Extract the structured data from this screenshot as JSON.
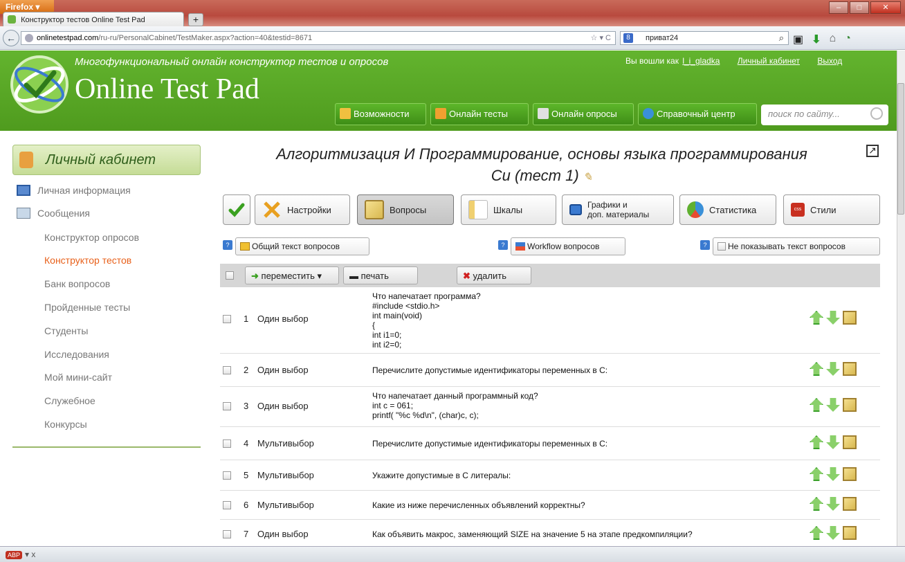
{
  "browser": {
    "menu_button": "Firefox ▾",
    "tab_title": "Конструктор тестов Online Test Pad",
    "url_host": "onlinetestpad.com",
    "url_path": "/ru-ru/PersonalCabinet/TestMaker.aspx?action=40&testid=8671",
    "search_value": "приват24",
    "search_engine": "8",
    "status_text": "x"
  },
  "header": {
    "tagline": "Многофункциональный онлайн конструктор тестов и опросов",
    "brand": "Online Test Pad",
    "logged_in_label": "Вы вошли как",
    "username": "l_i_gladka",
    "cabinet_link": "Личный кабинет",
    "logout_link": "Выход",
    "nav": [
      {
        "label": "Возможности",
        "color": "#f0c040"
      },
      {
        "label": "Онлайн тесты",
        "color": "#f0a030"
      },
      {
        "label": "Онлайн опросы",
        "color": "#e0e0e0"
      },
      {
        "label": "Справочный центр",
        "color": "#3a90d8"
      }
    ],
    "search_placeholder": "поиск по сайту..."
  },
  "sidebar": {
    "title": "Личный кабинет",
    "items": [
      {
        "label": "Личная информация"
      },
      {
        "label": "Сообщения"
      },
      {
        "label": "Конструктор опросов"
      },
      {
        "label": "Конструктор тестов"
      },
      {
        "label": "Банк вопросов"
      },
      {
        "label": "Пройденные тесты"
      },
      {
        "label": "Студенты"
      },
      {
        "label": "Исследования"
      },
      {
        "label": "Мой мини-сайт"
      },
      {
        "label": "Служебное"
      },
      {
        "label": "Конкурсы"
      }
    ],
    "active_index": 3
  },
  "main": {
    "title_line1": "Алгоритмизация И Программирование, основы языка программирования",
    "title_line2": "Си (тест 1)",
    "toolbar": {
      "settings": "Настройки",
      "questions": "Вопросы",
      "scales": "Шкалы",
      "graphics_line1": "Графики и",
      "graphics_line2": "доп. материалы",
      "statistics": "Статистика",
      "styles": "Стили"
    },
    "options": {
      "common_text": "Общий текст вопросов",
      "workflow": "Workflow вопросов",
      "hide_text": "Не показывать текст вопросов"
    },
    "actions": {
      "move": "переместить",
      "print": "печать",
      "delete": "удалить"
    },
    "questions": [
      {
        "num": "1",
        "type": "Один выбор",
        "text": "Что напечатает программа?\n#include <stdio.h>\nint main(void)\n{\nint i1=0;\nint i2=0;"
      },
      {
        "num": "2",
        "type": "Один выбор",
        "text": "Перечислите допустимые идентификаторы переменных в С:"
      },
      {
        "num": "3",
        "type": "Один выбор",
        "text": "Что напечатает данный программный код?\nint c = 061;\nprintf( \"%c %d\\n\", (char)c, c);"
      },
      {
        "num": "4",
        "type": "Мультивыбор",
        "text": "Перечислите допустимые идентификаторы переменных в С:"
      },
      {
        "num": "5",
        "type": "Мультивыбор",
        "text": "Укажите допустимые в С литералы:"
      },
      {
        "num": "6",
        "type": "Мультивыбор",
        "text": "Какие из ниже перечисленных объявлений корректны?"
      },
      {
        "num": "7",
        "type": "Один выбор",
        "text": "Как объявить макрос, заменяющий SIZE на значение 5 на этапе предкомпиляции?"
      }
    ]
  }
}
